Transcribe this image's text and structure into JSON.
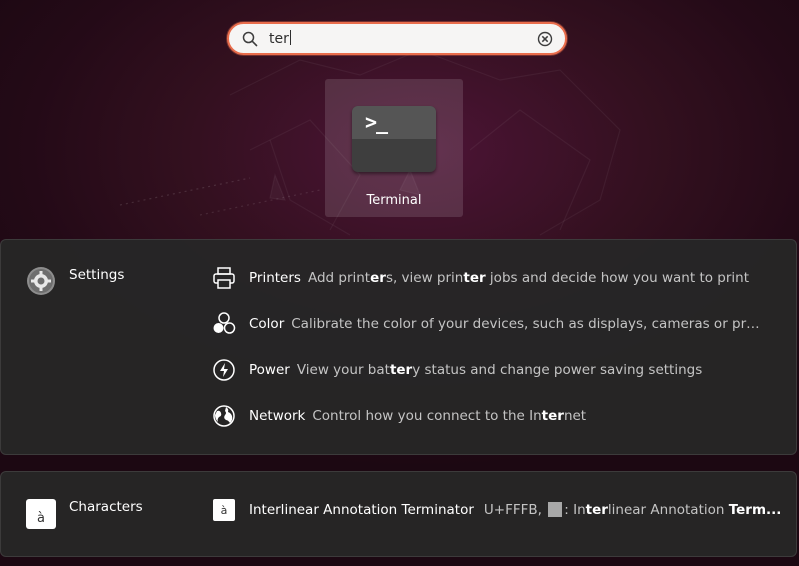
{
  "search": {
    "query": "ter",
    "search_icon": "search-icon",
    "clear_icon": "clear-icon"
  },
  "apps": [
    {
      "label": "Terminal",
      "icon": "terminal-icon",
      "icon_text": ">_"
    }
  ],
  "providers": [
    {
      "name": "Settings",
      "icon": "settings-icon",
      "results": [
        {
          "title": "Printers",
          "icon": "printer-icon",
          "desc": "Add print<b>er</b>s, view prin<b>ter</b> jobs and decide how you want to print"
        },
        {
          "title": "Color",
          "icon": "color-icon",
          "desc": "Calibrate the color of your devices, such as displays, cameras or print<b>...</b>"
        },
        {
          "title": "Power",
          "icon": "power-icon",
          "desc": "View your bat<b>ter</b>y status and change power saving settings"
        },
        {
          "title": "Network",
          "icon": "network-icon",
          "desc": "Control how you connect to the In<b>ter</b>net"
        }
      ]
    },
    {
      "name": "Characters",
      "icon": "characters-icon",
      "icon_glyph": "à",
      "results": [
        {
          "title": "Interlinear Annotation Terminator",
          "icon": "character-icon",
          "icon_glyph": "à",
          "desc_prefix": "U+FFFB,",
          "desc_suffix": ": In<b>ter</b>linear Annotation <b>Term...</b>"
        }
      ]
    }
  ],
  "colors": {
    "accent": "#e96d4c",
    "panel": "#262626",
    "background": "#2c0d1d"
  }
}
